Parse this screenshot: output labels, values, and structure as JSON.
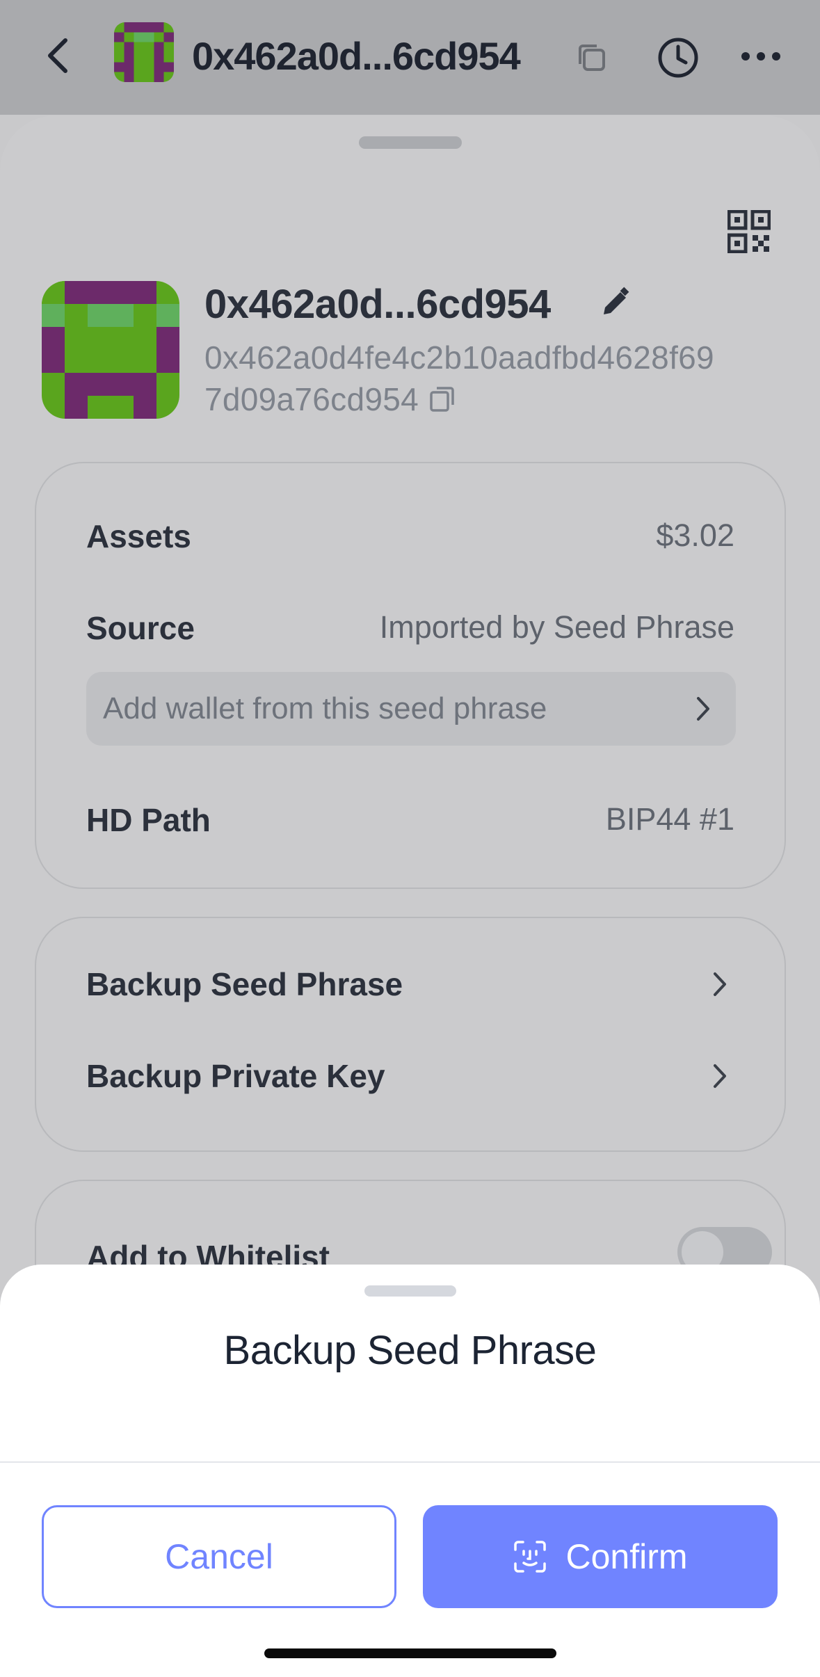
{
  "header": {
    "title": "0x462a0d...6cd954",
    "icons": [
      "back-icon",
      "avatar",
      "copy-icon",
      "history-icon",
      "more-icon"
    ]
  },
  "account": {
    "name": "0x462a0d...6cd954",
    "address_line1": "0x462a0d4fe4c2b10aadfbd4628f69",
    "address_line2": "7d09a76cd954"
  },
  "info_card": {
    "assets_label": "Assets",
    "assets_value": "$3.02",
    "source_label": "Source",
    "source_value": "Imported by Seed Phrase",
    "add_wallet_label": "Add wallet from this seed phrase",
    "hd_path_label": "HD Path",
    "hd_path_value": "BIP44 #1"
  },
  "backup_card": {
    "seed_phrase_label": "Backup Seed Phrase",
    "private_key_label": "Backup Private Key"
  },
  "whitelist_card": {
    "label": "Add to Whitelist",
    "toggle_on": false
  },
  "modal": {
    "title": "Backup Seed Phrase",
    "cancel_label": "Cancel",
    "confirm_label": "Confirm"
  },
  "colors": {
    "accent": "#7084ff",
    "avatar_green": "#5bb31c",
    "avatar_purple": "#7b2a7e",
    "avatar_light_green": "#6ed06a"
  }
}
